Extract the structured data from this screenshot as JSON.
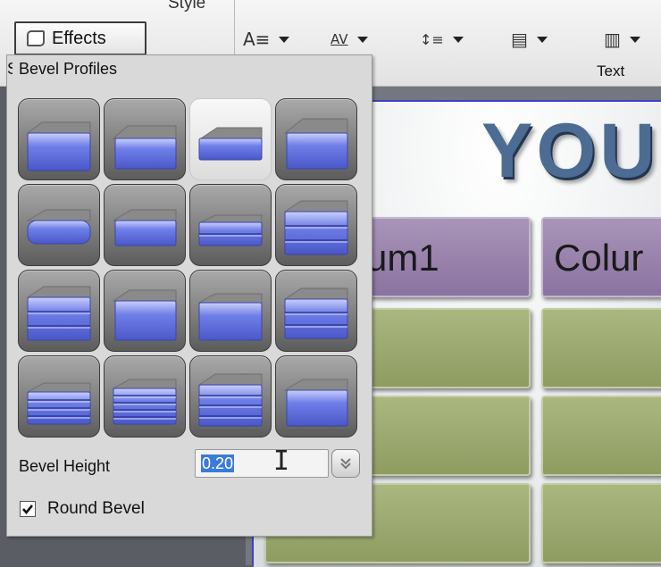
{
  "ribbon": {
    "style_label": "Style",
    "effects_label": "Effects",
    "text_group_label": "Text",
    "tools": [
      {
        "icon": "font-size-icon",
        "glyph": "A≡"
      },
      {
        "icon": "character-spacing-icon",
        "glyph": "AV"
      },
      {
        "icon": "line-spacing-icon",
        "glyph": "↕≡"
      },
      {
        "icon": "align-text-icon",
        "glyph": "▤"
      },
      {
        "icon": "columns-icon",
        "glyph": "▥"
      }
    ]
  },
  "slide": {
    "title": "YOU",
    "columns": [
      "um1",
      "Colur"
    ]
  },
  "bevel_panel": {
    "title": "Bevel Profiles",
    "cut_off_letter": "S",
    "profiles": [
      {
        "icon": "bevel-flat-icon"
      },
      {
        "icon": "bevel-angle-icon"
      },
      {
        "icon": "bevel-slope-icon",
        "selected": true
      },
      {
        "icon": "bevel-cove-icon"
      },
      {
        "icon": "bevel-round-icon"
      },
      {
        "icon": "bevel-chisel-icon"
      },
      {
        "icon": "bevel-step-icon"
      },
      {
        "icon": "bevel-ogee-icon"
      },
      {
        "icon": "bevel-double-step-icon"
      },
      {
        "icon": "bevel-notch-icon"
      },
      {
        "icon": "bevel-soft-icon"
      },
      {
        "icon": "bevel-ridge-icon"
      },
      {
        "icon": "bevel-layered-icon"
      },
      {
        "icon": "bevel-stripes-icon"
      },
      {
        "icon": "bevel-stack-icon"
      },
      {
        "icon": "bevel-curve-icon"
      }
    ],
    "bevel_height_label": "Bevel Height",
    "bevel_height_value": "0.20",
    "round_bevel_label": "Round Bevel",
    "round_bevel_checked": true
  },
  "colors": {
    "bevel_face": "#6f7fe8",
    "selection": "#3b7bd9",
    "header_purple": "#9a84ad",
    "cell_green": "#9cab70",
    "title_blue": "#4d6c94"
  }
}
